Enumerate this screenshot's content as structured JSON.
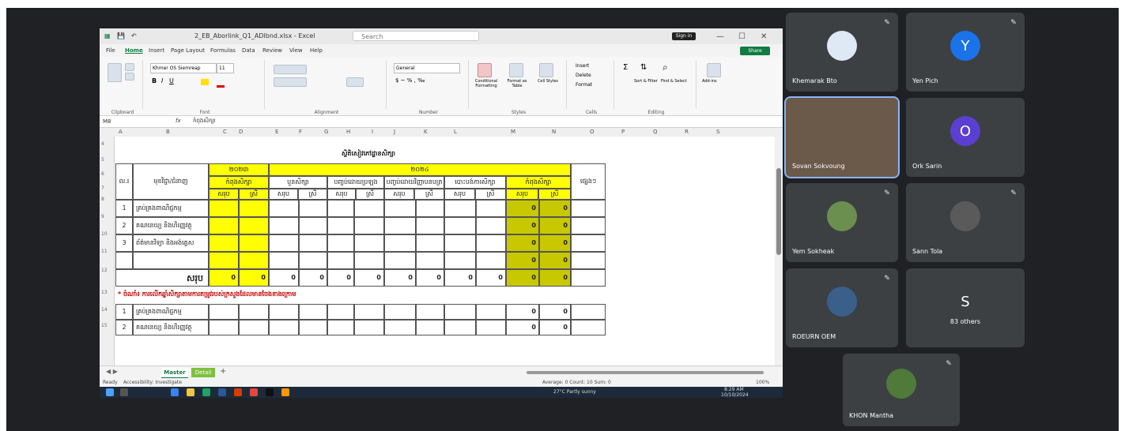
{
  "excel": {
    "title": "2_EB_Aborlink_Q1_ADlbnd.xlsx - Excel",
    "search_placeholder": "Search",
    "signin_label": "Sign in",
    "share_label": "Share",
    "menu": [
      "File",
      "Home",
      "Insert",
      "Page Layout",
      "Formulas",
      "Data",
      "Review",
      "View",
      "Help"
    ],
    "ribbon_groups": [
      "Clipboard",
      "Font",
      "Alignment",
      "Number",
      "Styles",
      "Cells",
      "Editing",
      "Add-ins"
    ],
    "font_name": "Khmer OS Siemreap",
    "font_size": "11",
    "number_format": "General",
    "styles_buttons": [
      "Conditional Formatting",
      "Format as Table",
      "Cell Styles"
    ],
    "cells_buttons": [
      "Insert",
      "Delete",
      "Format"
    ],
    "editing_buttons": [
      "Sort & Filter",
      "Find & Select"
    ],
    "addins_label": "Add-ins",
    "name_box": "M8",
    "formula": "កំពុងសិក្សា",
    "columns": [
      "A",
      "B",
      "C",
      "D",
      "E",
      "F",
      "G",
      "H",
      "I",
      "J",
      "K",
      "L",
      "M",
      "N",
      "O",
      "P",
      "Q",
      "R",
      "S"
    ],
    "rows": [
      "4",
      "5",
      "6",
      "7",
      "8",
      "9",
      "10",
      "11",
      "12",
      "13",
      "14",
      "15"
    ],
    "table": {
      "title": "ស្ថិតិសៀវភៅដ្ឋានសិក្សា",
      "group1_header": "២០២៣",
      "group2_header": "២០២៤",
      "col_no": "ល.រ",
      "col_unit": "មុខវិជ្ជា/ជំនាញ",
      "col_note": "ផ្សេងៗ",
      "sub_headers": [
        "កំពុងសិក្សា",
        "បួនសិក្សា",
        "បញ្ចប់ដោយប្រឡង",
        "បញ្ចប់ដោយវិញ្ញាបនបត្រ",
        "បោះបង់ការសិក្សា",
        "កំពុងសិក្សា"
      ],
      "sub_sub": [
        "សរុប",
        "ស្រី"
      ],
      "rows": [
        {
          "no": "1",
          "name": "គ្រប់គ្រងពាណិជ្ជកម្ម",
          "m": "0",
          "n": "0"
        },
        {
          "no": "2",
          "name": "គណនេយ្យ និងហិរញ្ញវត្ថុ",
          "m": "0",
          "n": "0"
        },
        {
          "no": "3",
          "name": "ព័ត៌មានវិទ្យា និងអង់គ្លេស",
          "m": "0",
          "n": "0"
        },
        {
          "no": "",
          "name": "",
          "m": "0",
          "n": "0"
        }
      ],
      "total_label": "សរុប",
      "totals": [
        "0",
        "0",
        "0",
        "0",
        "0",
        "0",
        "0",
        "0",
        "0",
        "0",
        "0",
        "0"
      ],
      "note_row": "* ចំណាំ៖ ការលើកឆ្នាំសិក្សាតាមការតម្រូវរបស់ក្រសួងដែលមានចែងខាងក្រោម",
      "extra_rows": [
        {
          "no": "1",
          "name": "គ្រប់គ្រងពាណិជ្ជកម្ម",
          "m": "0",
          "n": "0"
        },
        {
          "no": "2",
          "name": "គណនេយ្យ និងហិរញ្ញវត្ថុ",
          "m": "0",
          "n": "0"
        }
      ]
    },
    "sheet_tabs": [
      "Master",
      "Detail"
    ],
    "status_left": "Ready",
    "status_accessibility": "Accessibility: Investigate",
    "status_right": "Average: 0   Count: 10   Sum: 0",
    "zoom": "100%",
    "taskbar_weather": "27°C Partly sunny",
    "taskbar_time": "8:29 AM",
    "taskbar_date": "10/10/2024"
  },
  "participants": [
    {
      "name": "Khemarak Bto",
      "initial": "",
      "color": "#dfe8f5",
      "muted": true
    },
    {
      "name": "Yen Pich",
      "initial": "Y",
      "color": "#1a73e8",
      "muted": true
    },
    {
      "name": "Sovan Sokvoung",
      "initial": "",
      "color": "#8a6a4a",
      "muted": false
    },
    {
      "name": "Ork Sarin",
      "initial": "O",
      "color": "#5b3fd1",
      "muted": false
    },
    {
      "name": "Yem Sokheak",
      "initial": "",
      "color": "#6b8f4e",
      "muted": true
    },
    {
      "name": "Sann Tola",
      "initial": "",
      "color": "#5a5a5a",
      "muted": true
    },
    {
      "name": "ROEURN OEM",
      "initial": "",
      "color": "#3a5f8a",
      "muted": true
    },
    {
      "name": "83 others",
      "initial": "S",
      "color": "#3c4043",
      "muted": false
    },
    {
      "name": "KHON Mantha",
      "initial": "",
      "color": "#4f7a3a",
      "muted": true
    }
  ]
}
